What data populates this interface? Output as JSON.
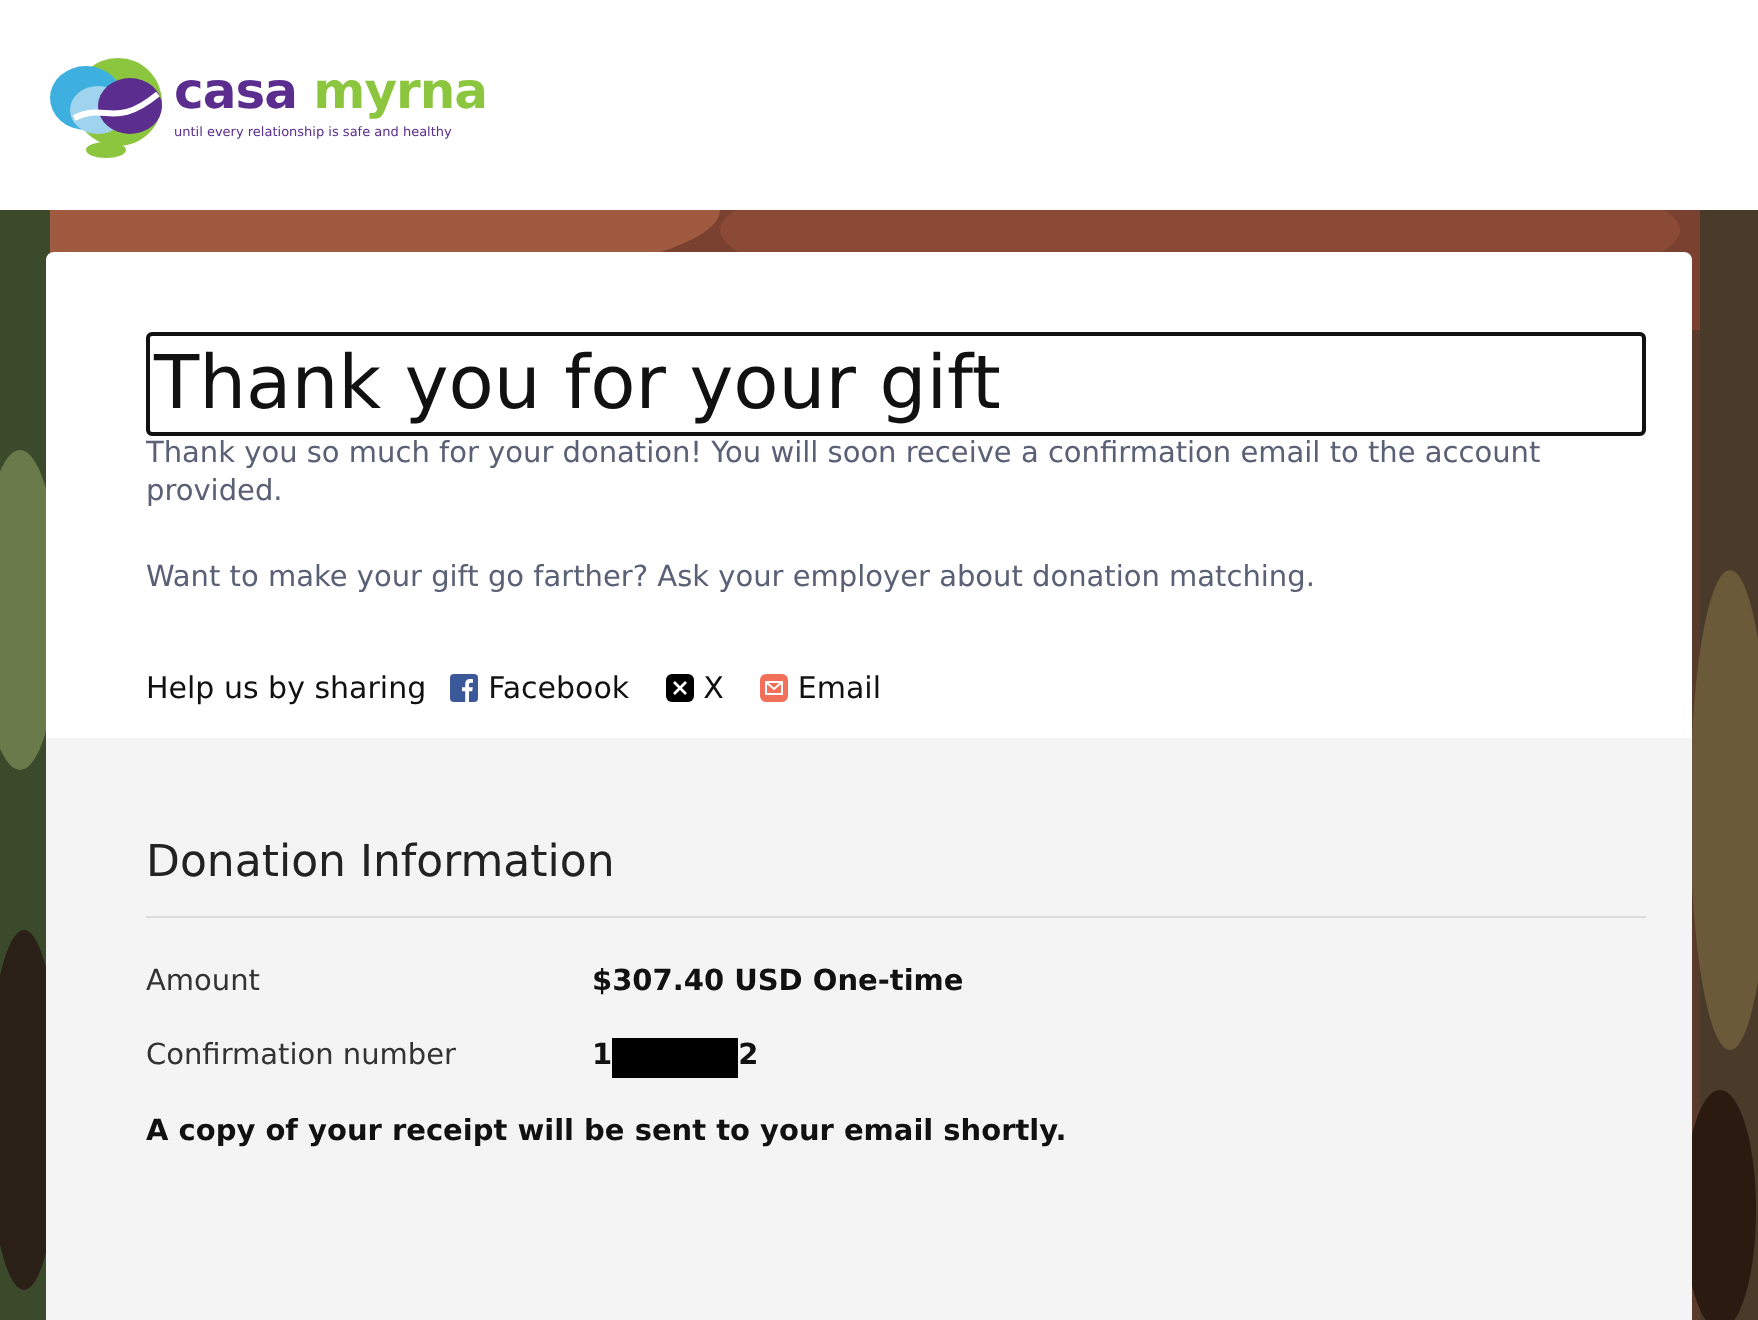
{
  "logo": {
    "name": "casa myrna",
    "tagline": "until every relationship is safe and healthy"
  },
  "thanks": {
    "title": "Thank you for your gift",
    "title_focused": true,
    "message": "Thank you so much for your donation! You will soon receive a confirmation email to the account provided.",
    "matching": "Want to make your gift go farther? Ask your employer about donation matching."
  },
  "sharing": {
    "label": "Help us by sharing",
    "links": [
      {
        "kind": "facebook",
        "label": "Facebook"
      },
      {
        "kind": "x",
        "label": "X"
      },
      {
        "kind": "email",
        "label": "Email"
      }
    ]
  },
  "donation": {
    "heading": "Donation Information",
    "fields": [
      {
        "label": "Amount",
        "value": "$307.40 USD One-time",
        "redacted": false
      },
      {
        "label": "Confirmation number",
        "value_start": "1",
        "value_end": "2",
        "redacted": true
      }
    ],
    "note": "A copy of your receipt will be sent to your email shortly."
  }
}
